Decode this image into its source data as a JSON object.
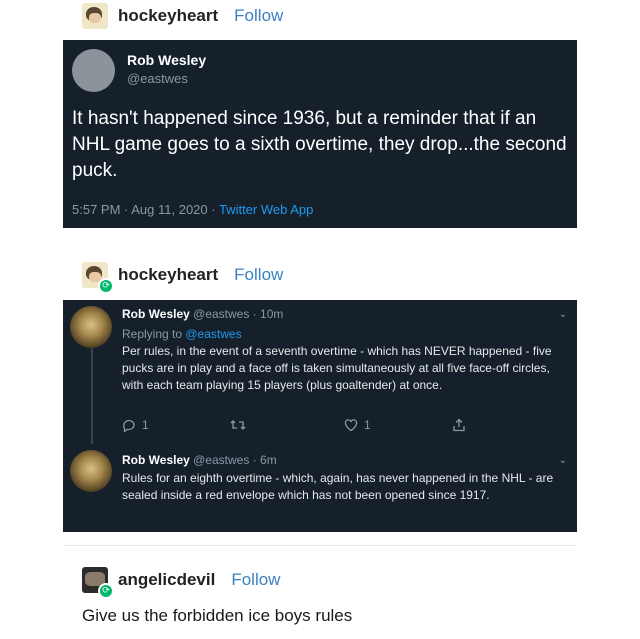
{
  "post1": {
    "username": "hockeyheart",
    "follow": "Follow"
  },
  "tweet1": {
    "name": "Rob Wesley",
    "handle": "@eastwes",
    "text": "It hasn't happened since 1936, but a reminder that if an NHL game goes to a sixth overtime, they drop...the second puck.",
    "timestamp": "5:57 PM · Aug 11, 2020 · ",
    "app": "Twitter Web App"
  },
  "post2": {
    "username": "hockeyheart",
    "follow": "Follow"
  },
  "reply1": {
    "name": "Rob Wesley",
    "meta": " @eastwes · 10m",
    "replying_prefix": "Replying to ",
    "replying_handle": "@eastwes",
    "text": "Per rules, in the event of a seventh overtime - which has NEVER happened - five pucks are in play and a face off is taken simultaneously at all five face-off circles, with each team playing 15 players (plus goaltender) at once.",
    "reply_count": "1",
    "like_count": "1"
  },
  "reply2": {
    "name": "Rob Wesley",
    "meta": " @eastwes · 6m",
    "text": "Rules for an eighth overtime - which, again, has never happened in the NHL - are sealed inside a red envelope which has not been opened since 1917."
  },
  "post3": {
    "username": "angelicdevil",
    "follow": "Follow",
    "comment": "Give us the forbidden ice boys rules"
  },
  "icons": [
    "reblog-icon",
    "reply-icon",
    "retweet-icon",
    "like-icon",
    "share-icon",
    "chevron-down-icon"
  ]
}
